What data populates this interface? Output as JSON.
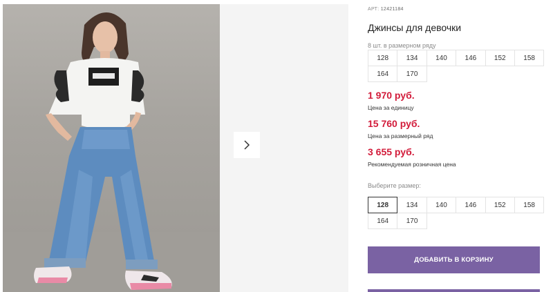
{
  "product": {
    "article_label": "АРТ:",
    "article_number": "12421184",
    "title": "Джинсы для девочки",
    "size_row_note": "8 шт. в размерном ряду"
  },
  "size_row": [
    "128",
    "134",
    "140",
    "146",
    "152",
    "158",
    "164",
    "170"
  ],
  "prices": {
    "unit_price": "1 970 руб.",
    "unit_label": "Цена за единицу",
    "row_price": "15 760 руб.",
    "row_label": "Цена за размерный ряд",
    "retail_price": "3 655 руб.",
    "retail_label": "Рекомендуемая розничная цена"
  },
  "size_select": {
    "label": "Выберите размер:",
    "options": [
      "128",
      "134",
      "140",
      "146",
      "152",
      "158",
      "164",
      "170"
    ],
    "selected": "128"
  },
  "actions": {
    "add_to_cart": "ДОБАВИТЬ В КОРЗИНУ"
  },
  "icons": {
    "next": "chevron-right-icon"
  },
  "colors": {
    "price": "#d21b3a",
    "button": "#7a62a3"
  }
}
